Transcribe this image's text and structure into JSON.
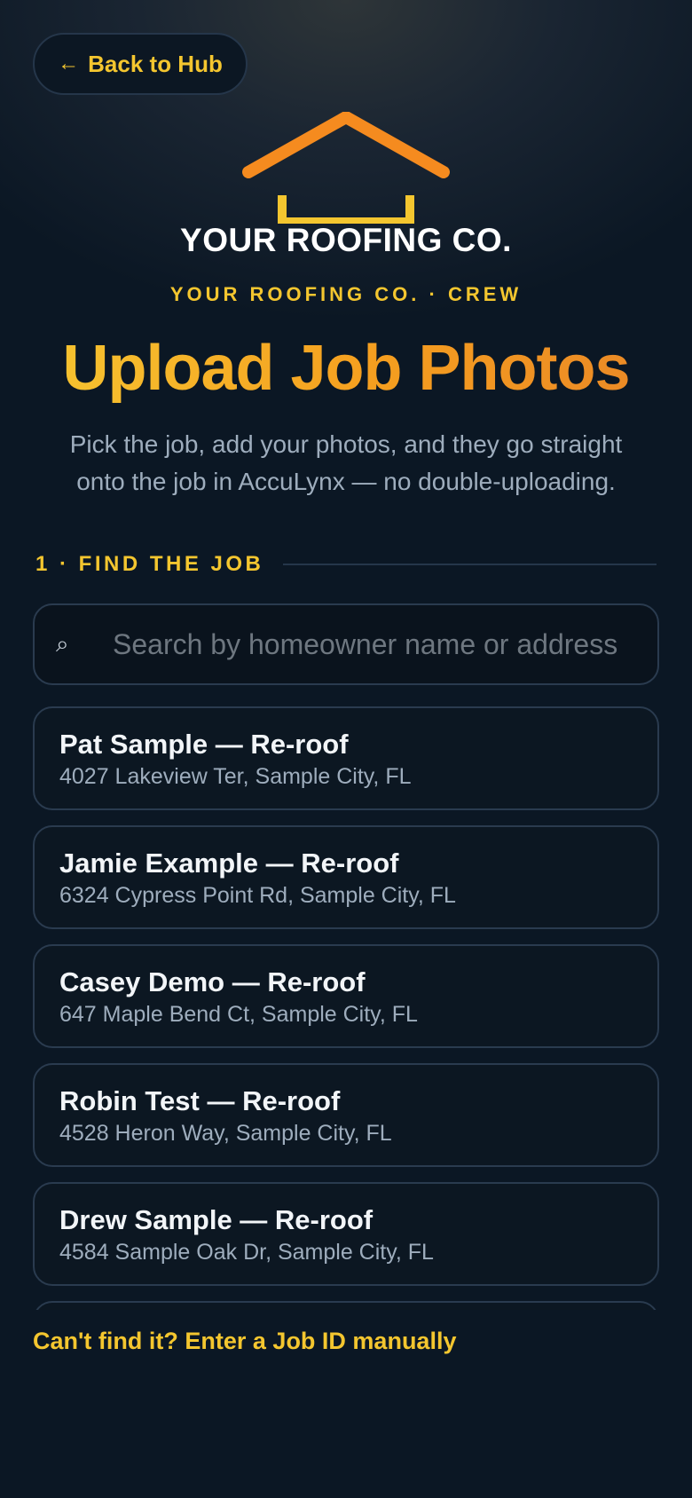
{
  "header": {
    "back_label": "Back to Hub",
    "back_icon": "arrow-left-icon",
    "brand_name": "YOUR ROOFING CO.",
    "crew_label": "YOUR ROOFING CO. · CREW",
    "title": "Upload Job Photos",
    "subtitle": "Pick the job, add your photos, and they go straight onto the job in AccuLynx — no double-uploading."
  },
  "colors": {
    "accent_yellow": "#f4c62f",
    "accent_orange": "#f58b1f",
    "background": "#0b1724"
  },
  "section": {
    "label": "1 · FIND THE JOB"
  },
  "search": {
    "icon": "search-icon",
    "placeholder": "Search by homeowner name or address",
    "value": ""
  },
  "jobs": [
    {
      "name": "Pat Sample — Re-roof",
      "address": "4027 Lakeview Ter, Sample City, FL"
    },
    {
      "name": "Jamie Example — Re-roof",
      "address": "6324 Cypress Point Rd, Sample City, FL"
    },
    {
      "name": "Casey Demo — Re-roof",
      "address": "647 Maple Bend Ct, Sample City, FL"
    },
    {
      "name": "Robin Test — Re-roof",
      "address": "4528 Heron Way, Sample City, FL"
    },
    {
      "name": "Drew Sample — Re-roof",
      "address": "4584 Sample Oak Dr, Sample City, FL"
    },
    {
      "name": "",
      "address": ""
    }
  ],
  "footer": {
    "manual_link": "Can't find it? Enter a Job ID manually"
  }
}
